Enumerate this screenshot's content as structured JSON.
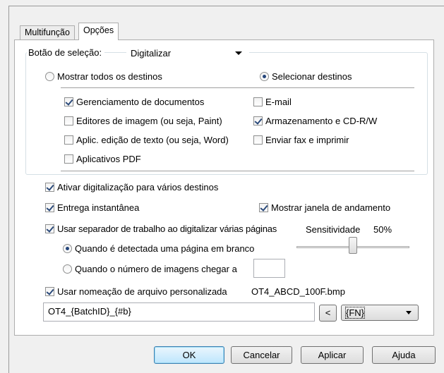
{
  "tabs": [
    {
      "label": "Multifunção",
      "active": false
    },
    {
      "label": "Opções",
      "active": true
    }
  ],
  "selection": {
    "label": "Botão de seleção:",
    "value": "Digitalizar"
  },
  "destinations_mode": {
    "show_all": {
      "label": "Mostrar todos os destinos",
      "checked": false
    },
    "select": {
      "label": "Selecionar destinos",
      "checked": true
    }
  },
  "destinations": {
    "doc_management": {
      "label": "Gerenciamento de documentos",
      "checked": true
    },
    "email": {
      "label": "E-mail",
      "checked": false
    },
    "image_editors": {
      "label": "Editores de imagem (ou seja, Paint)",
      "checked": false
    },
    "storage_cd": {
      "label": "Armazenamento e CD-R/W",
      "checked": true
    },
    "text_editors": {
      "label": "Aplic. edição de texto (ou seja, Word)",
      "checked": false
    },
    "fax_print": {
      "label": "Enviar fax e imprimir",
      "checked": false
    },
    "pdf_apps": {
      "label": "Aplicativos PDF",
      "checked": false
    }
  },
  "options": {
    "multi_dest": {
      "label": "Ativar digitalização para vários destinos",
      "checked": true
    },
    "instant_delivery": {
      "label": "Entrega instantânea",
      "checked": true
    },
    "show_progress": {
      "label": "Mostrar janela de andamento",
      "checked": true
    },
    "job_separator": {
      "label": "Usar separador de trabalho ao digitalizar várias páginas",
      "checked": true
    },
    "blank_page": {
      "label": "Quando é detectada uma página em branco",
      "checked": true
    },
    "image_count": {
      "label": "Quando o número de imagens chegar a",
      "checked": false,
      "value": ""
    },
    "sensitivity_label": "Sensitividade",
    "sensitivity_value": "50%",
    "sensitivity_level": 0.5
  },
  "file_naming": {
    "label": "Usar nomeação de arquivo personalizada",
    "checked": true,
    "preview": "OT4_ABCD_100F.bmp",
    "pattern": "OT4_{BatchID}_{#b}",
    "insert_label": "<",
    "token_value": "{FN}"
  },
  "buttons": {
    "ok": "OK",
    "cancel": "Cancelar",
    "apply": "Aplicar",
    "help": "Ajuda"
  }
}
